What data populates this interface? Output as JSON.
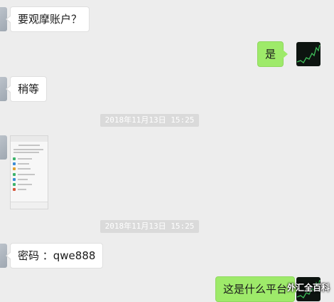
{
  "messages": [
    {
      "side": "left",
      "text": "要观摩账户？"
    },
    {
      "side": "right",
      "text": "是"
    },
    {
      "side": "left",
      "text": "稍等"
    },
    {
      "side": "left",
      "text": "密码 ：qwe888"
    },
    {
      "side": "right",
      "text": "这是什么平台"
    }
  ],
  "timestamps": [
    "2018年11月13日 15:25",
    "2018年11月13日 15:25"
  ],
  "watermark": "外汇全百科",
  "colors": {
    "background": "#ededed",
    "sent_bubble": "#9eea6a",
    "received_bubble": "#ffffff",
    "timestamp_bg": "#dadada"
  }
}
